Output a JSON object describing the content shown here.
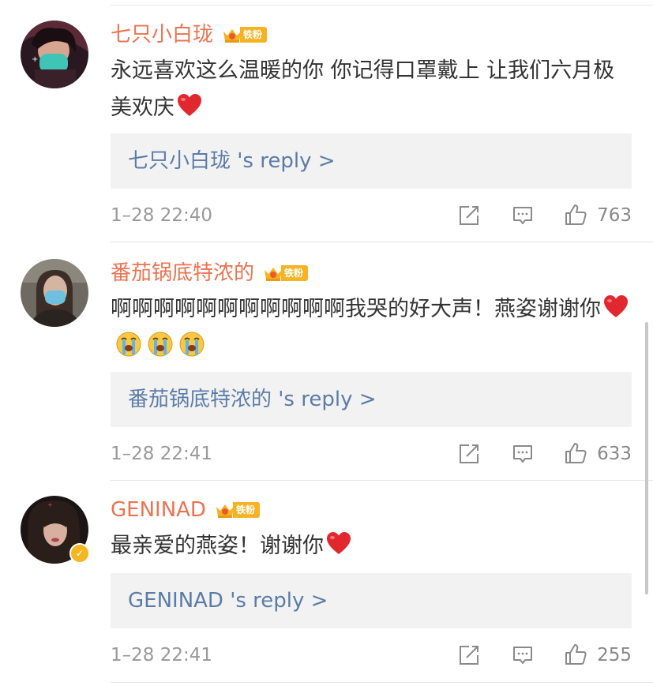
{
  "comments": [
    {
      "username": "七只小白珑",
      "badge": "铁粉",
      "text": "永远喜欢这么温暖的你 你记得口罩戴上 让我们六月极美欢庆",
      "emojis": [
        "heart-emoji"
      ],
      "reply_link": "七只小白珑  's reply >",
      "timestamp": "1–28 22:40",
      "likes": "763",
      "verified": false
    },
    {
      "username": "番茄锅底特浓的",
      "badge": "铁粉",
      "text": "啊啊啊啊啊啊啊啊啊啊啊我哭的好大声！燕姿谢谢你",
      "emojis": [
        "heart-emoji",
        "crying-face-emoji",
        "crying-face-emoji",
        "crying-face-emoji"
      ],
      "reply_link": "番茄锅底特浓的  's reply >",
      "timestamp": "1–28 22:41",
      "likes": "633",
      "verified": false
    },
    {
      "username": "GENINAD",
      "badge": "铁粉",
      "text": "最亲爱的燕姿！谢谢你",
      "emojis": [
        "heart-emoji"
      ],
      "reply_link": "GENINAD  's reply >",
      "timestamp": "1–28 22:41",
      "likes": "255",
      "verified": true
    }
  ],
  "colors": {
    "username": "#eb7350",
    "reply_link": "#5b7ca8",
    "badge": "#f5b323",
    "heart": "#e0282e",
    "meta": "#999999"
  }
}
